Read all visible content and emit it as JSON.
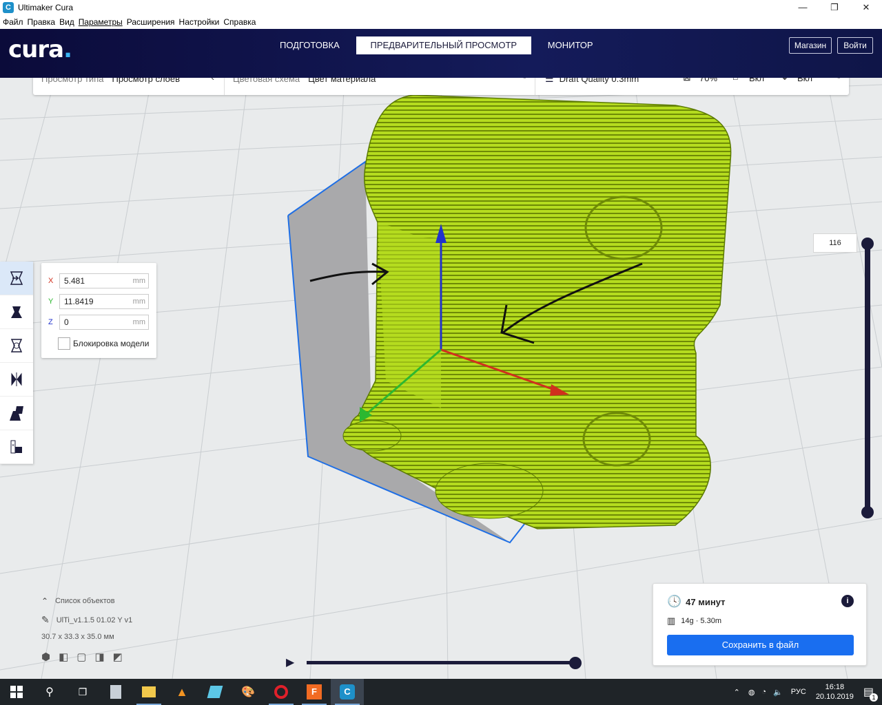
{
  "window": {
    "title": "Ultimaker Cura",
    "app_icon": "C",
    "min": "—",
    "max": "❐",
    "close": "✕"
  },
  "menu": [
    "Файл",
    "Правка",
    "Вид",
    "Параметры",
    "Расширения",
    "Настройки",
    "Справка"
  ],
  "header": {
    "logo": "cura",
    "logo_dot": ".",
    "stages": [
      "ПОДГОТОВКА",
      "ПРЕДВАРИТЕЛЬНЫЙ ПРОСМОТР",
      "МОНИТОР"
    ],
    "active_stage": "ПРЕДВАРИТЕЛЬНЫЙ ПРОСМОТР",
    "marketplace": "Магазин",
    "signin": "Войти"
  },
  "toolbar": {
    "view_type_label": "Просмотр типа",
    "view_type_value": "Просмотр слоёв",
    "color_scheme_label": "Цветовая схема",
    "color_scheme_value": "Цвет материала",
    "profile": "Draft Quality 0.3mm",
    "infill": "70%",
    "support": "Вкл",
    "adhesion": "Вкл"
  },
  "move_panel": {
    "x_label": "X",
    "x_value": "5.481",
    "y_label": "Y",
    "y_value": "11.8419",
    "z_label": "Z",
    "z_value": "0",
    "unit": "mm",
    "lock_label": "Блокировка модели"
  },
  "layer": {
    "current": "116"
  },
  "object_list": {
    "title": "Список объектов",
    "object_name": "UlTi_v1.1.5  01.02 Y v1",
    "dimensions": "30.7 x 33.3 x 35.0 мм"
  },
  "print_info": {
    "time": "47 минут",
    "material": "14g · 5.30m",
    "save": "Сохранить в файл",
    "info_icon": "i"
  },
  "taskbar": {
    "lang": "РУС",
    "time": "16:18",
    "date": "20.10.2019",
    "notif_count": "1"
  },
  "colors": {
    "accent": "#196ef0",
    "header_bg": "#0b0b3a",
    "model_green": "#b5dc1f",
    "model_dark": "#6e8a06"
  }
}
